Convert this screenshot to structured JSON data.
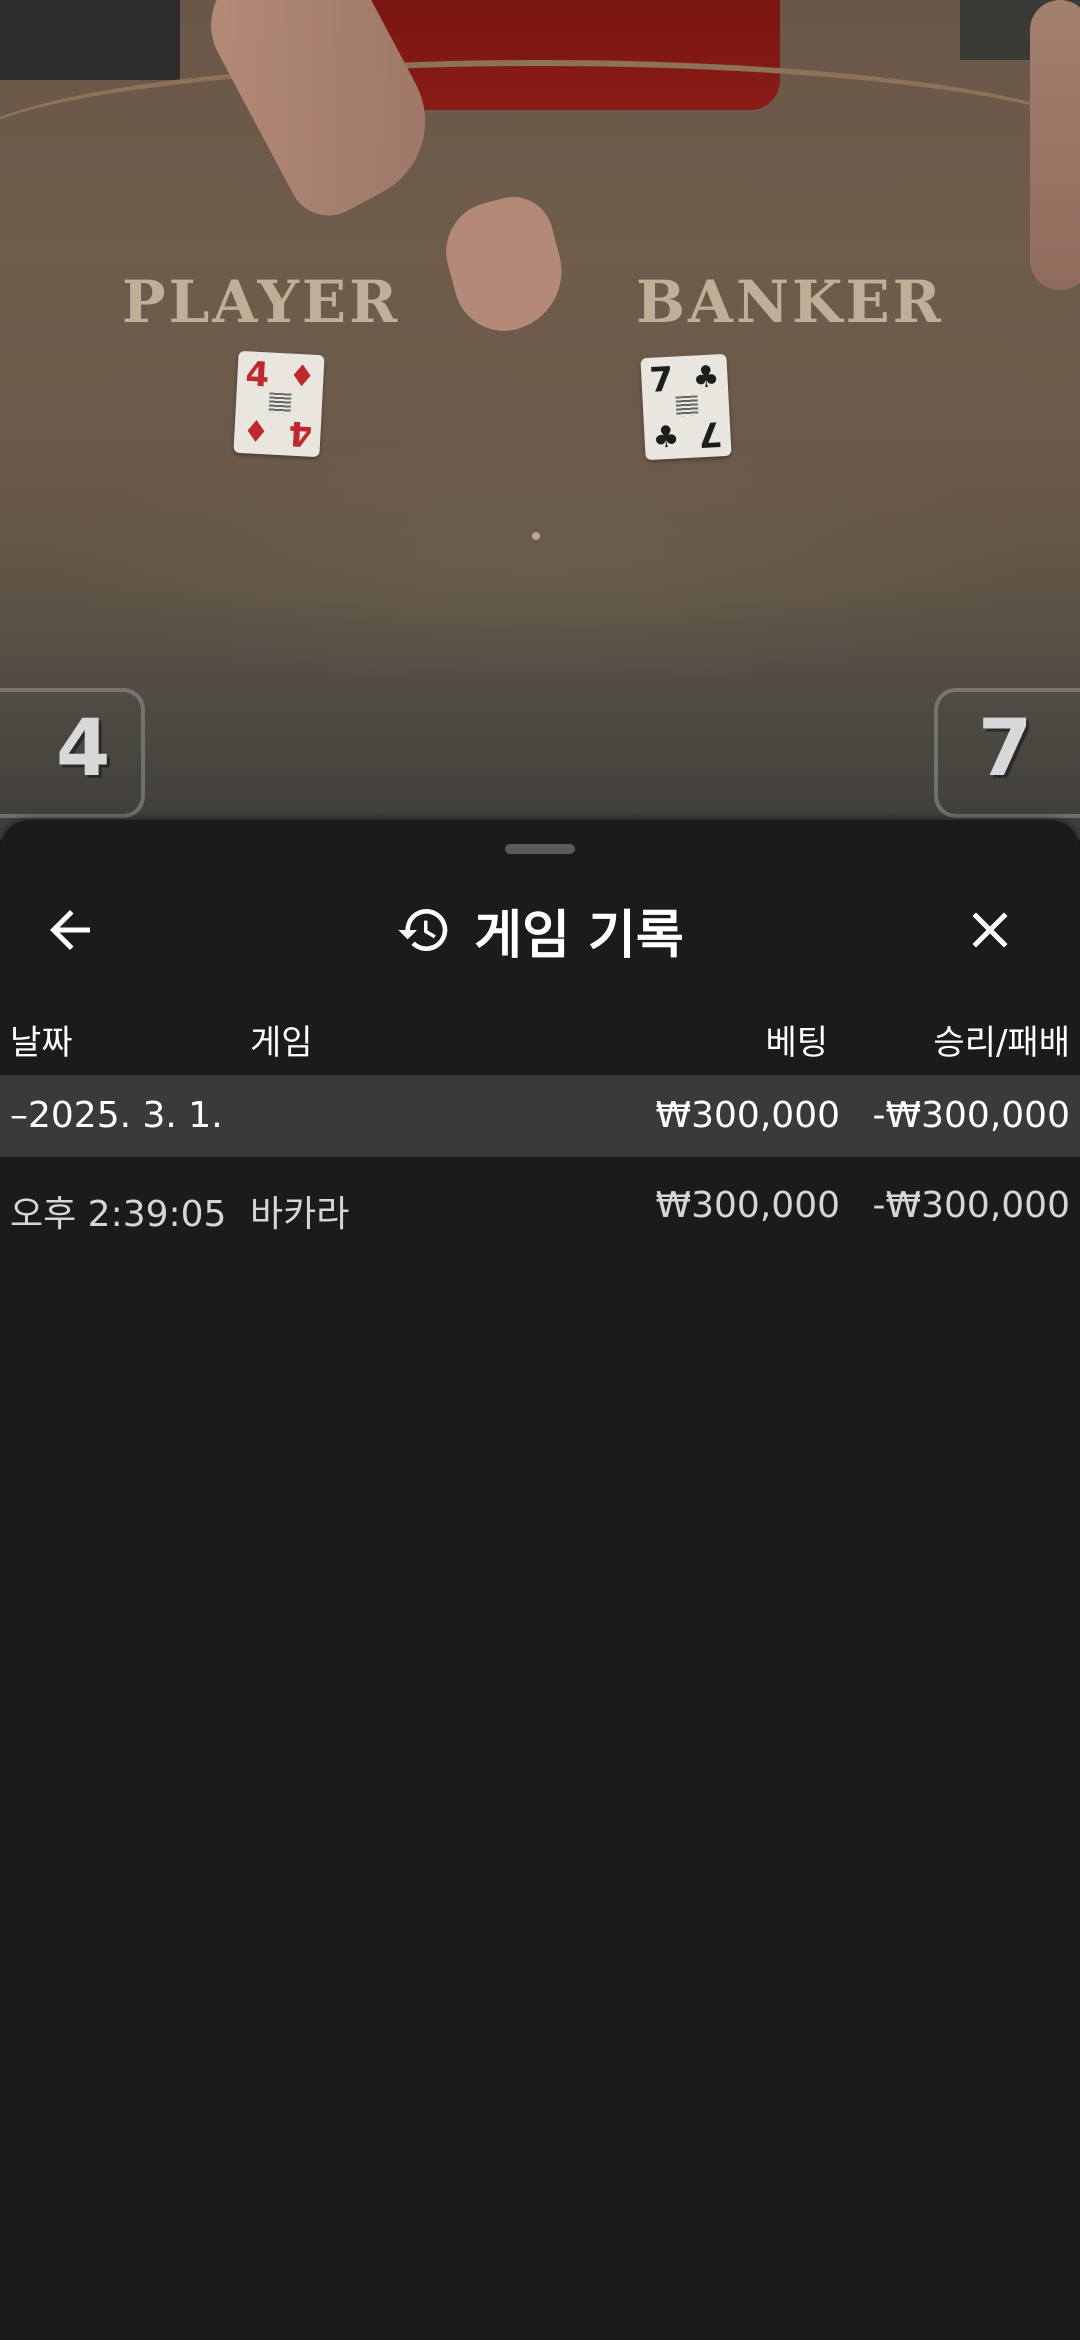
{
  "table": {
    "player_label": "PLAYER",
    "banker_label": "BANKER",
    "player_score": "4",
    "banker_score": "7",
    "player_card": {
      "rank": "4",
      "suit": "♦"
    },
    "banker_card": {
      "rank": "7",
      "suit": "♣"
    }
  },
  "sheet": {
    "title": "게임 기록",
    "columns": {
      "date": "날짜",
      "game": "게임",
      "bet": "베팅",
      "win_loss": "승리/패배"
    },
    "group_row": {
      "date": "–2025. 3. 1.",
      "bet": "₩300,000",
      "win_loss": "-₩300,000"
    },
    "rows": [
      {
        "time": "오후 2:39:05",
        "game": "바카라",
        "bet": "₩300,000",
        "win_loss": "-₩300,000"
      }
    ]
  },
  "colors": {
    "sheet_bg": "#1b1b1b",
    "group_row_bg": "#3a3a3a",
    "text": "#ffffff"
  }
}
